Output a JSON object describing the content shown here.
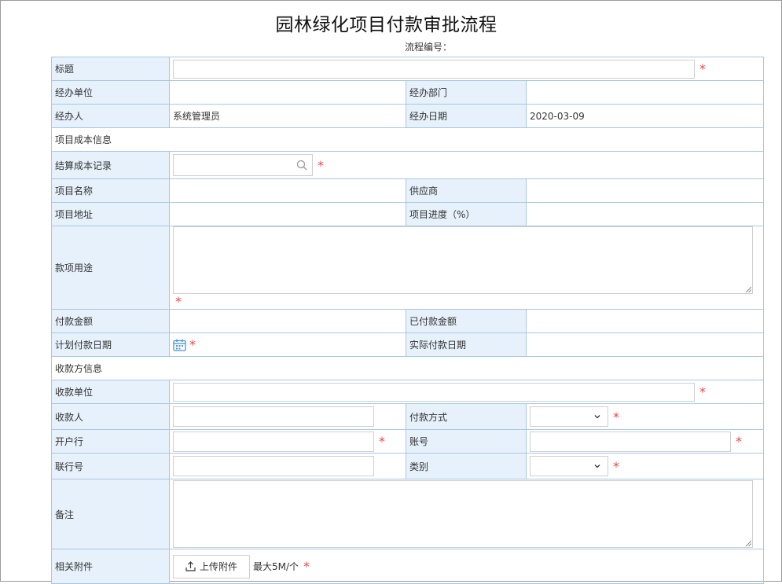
{
  "page": {
    "title": "园林绿化项目付款审批流程",
    "flow_no_label": "流程编号："
  },
  "form": {
    "title_label": "标题",
    "unit_label": "经办单位",
    "dept_label": "经办部门",
    "handler_label": "经办人",
    "handler_value": "系统管理员",
    "date_label": "经办日期",
    "date_value": "2020-03-09",
    "section_cost": "项目成本信息",
    "settle_label": "结算成本记录",
    "project_name_label": "项目名称",
    "supplier_label": "供应商",
    "project_addr_label": "项目地址",
    "progress_label": "项目进度（%）",
    "purpose_label": "款项用途",
    "pay_amount_label": "付款金额",
    "paid_amount_label": "已付款金额",
    "plan_date_label": "计划付款日期",
    "actual_date_label": "实际付款日期",
    "section_payee": "收款方信息",
    "payee_unit_label": "收款单位",
    "payee_label": "收款人",
    "pay_method_label": "付款方式",
    "bank_label": "开户行",
    "account_label": "账号",
    "bank_no_label": "联行号",
    "category_label": "类别",
    "remark_label": "备注",
    "attach_label": "相关附件",
    "upload_label": "上传附件",
    "upload_hint": "最大5M/个",
    "required_mark": "*"
  },
  "icons": {
    "search": "search-icon",
    "calendar": "calendar-icon",
    "chevron": "chevron-down-icon",
    "upload": "upload-icon"
  },
  "colors": {
    "label_bg": "#e6f1fb",
    "border": "#a9c7e0",
    "required": "#e84a4a",
    "calendar": "#4a90d9"
  }
}
